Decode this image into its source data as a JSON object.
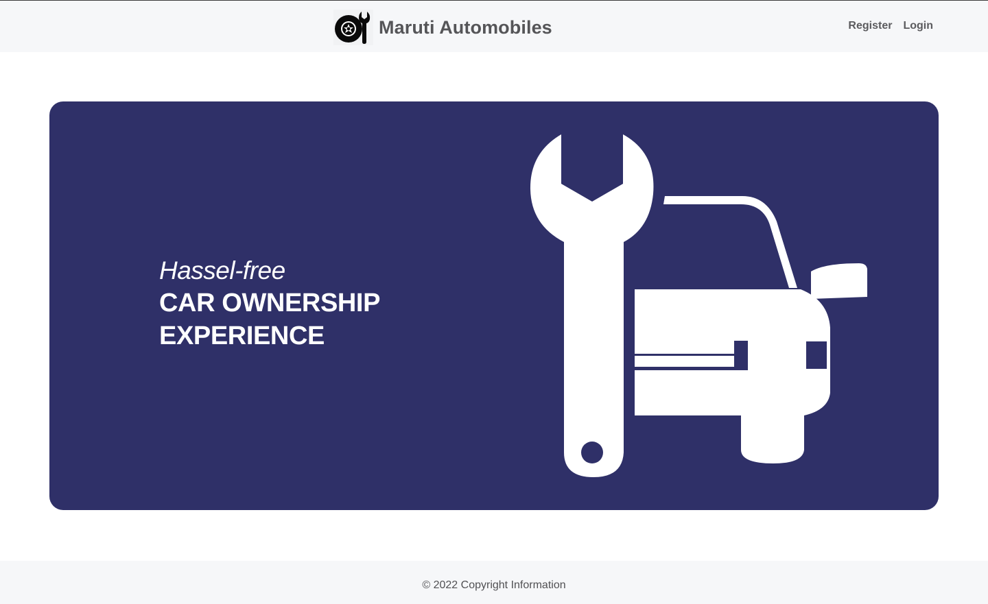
{
  "navbar": {
    "brand_name": "Maruti Automobiles",
    "logo_icon": "tyre-wrench-icon",
    "links": [
      {
        "label": "Register"
      },
      {
        "label": "Login"
      }
    ]
  },
  "hero": {
    "tagline": "Hassel-free",
    "heading_line1": "CAR OWNERSHIP",
    "heading_line2": "EXPERIENCE",
    "illustration_icon": "wrench-car-icon",
    "background_color": "#2f3068"
  },
  "footer": {
    "copyright": "© 2022 Copyright Information"
  }
}
